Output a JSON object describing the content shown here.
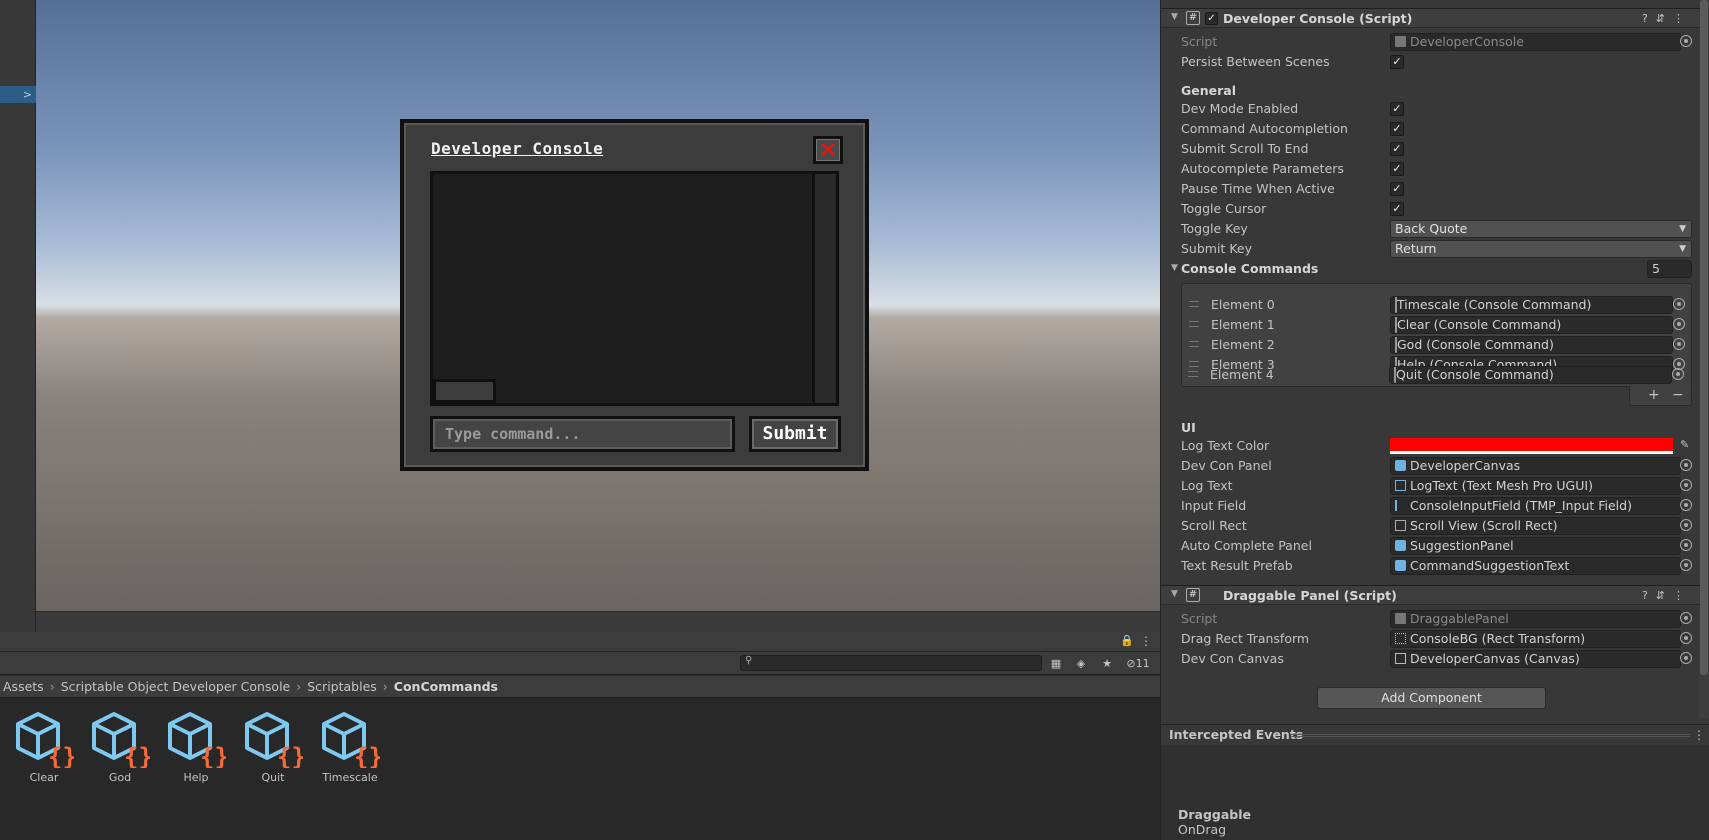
{
  "game_console": {
    "title": "Developer Console",
    "input_placeholder": "Type command...",
    "submit_label": "Submit"
  },
  "project": {
    "breadcrumb": [
      "Assets",
      "Scriptable Object Developer Console",
      "Scriptables",
      "ConCommands"
    ],
    "hidden_count": "11",
    "assets": [
      "Clear",
      "God",
      "Help",
      "Quit",
      "Timescale"
    ]
  },
  "inspector": {
    "dev_console_component": {
      "title": "Developer Console (Script)",
      "script_label": "Script",
      "script_value": "DeveloperConsole",
      "persist_label": "Persist Between Scenes",
      "general_header": "General",
      "toggles": [
        "Dev Mode Enabled",
        "Command Autocompletion",
        "Submit Scroll To End",
        "Autocomplete Parameters",
        "Pause Time When Active",
        "Toggle Cursor"
      ],
      "toggle_key_label": "Toggle Key",
      "toggle_key_value": "Back Quote",
      "submit_key_label": "Submit Key",
      "submit_key_value": "Return",
      "console_commands_label": "Console Commands",
      "console_commands_count": "5",
      "elements": [
        {
          "label": "Element 0",
          "value": "Timescale (Console Command)"
        },
        {
          "label": "Element 1",
          "value": "Clear (Console Command)"
        },
        {
          "label": "Element 2",
          "value": "God (Console Command)"
        },
        {
          "label": "Element 3",
          "value": "Help (Console Command)"
        },
        {
          "label": "Element 4",
          "value": "Quit (Console Command)"
        }
      ],
      "ui_header": "UI",
      "log_text_color_label": "Log Text Color",
      "log_text_color": "#ff0000",
      "refs": [
        {
          "label": "Dev Con Panel",
          "value": "DeveloperCanvas",
          "icon": "gameobject-icon"
        },
        {
          "label": "Log Text",
          "value": "LogText (Text Mesh Pro UGUI)",
          "icon": "text-icon"
        },
        {
          "label": "Input Field",
          "value": "ConsoleInputField (TMP_Input Field)",
          "icon": "input-field-icon"
        },
        {
          "label": "Scroll Rect",
          "value": "Scroll View (Scroll Rect)",
          "icon": "scroll-rect-icon"
        },
        {
          "label": "Auto Complete Panel",
          "value": "SuggestionPanel",
          "icon": "gameobject-icon"
        },
        {
          "label": "Text Result Prefab",
          "value": "CommandSuggestionText",
          "icon": "gameobject-icon"
        }
      ]
    },
    "draggable_component": {
      "title": "Draggable Panel (Script)",
      "script_label": "Script",
      "script_value": "DraggablePanel",
      "drag_rect_label": "Drag Rect Transform",
      "drag_rect_value": "ConsoleBG (Rect Transform)",
      "dev_con_canvas_label": "Dev Con Canvas",
      "dev_con_canvas_value": "DeveloperCanvas (Canvas)"
    },
    "add_component_label": "Add Component",
    "intercepted_events": {
      "title": "Intercepted Events",
      "name": "Draggable",
      "event": "OnDrag"
    }
  },
  "colors": {
    "selection_blue": "#2c5d87",
    "asset_icon_blue": "#7fc8f0",
    "asset_icon_orange": "#f26b3a",
    "close_red": "#d11c1c"
  }
}
